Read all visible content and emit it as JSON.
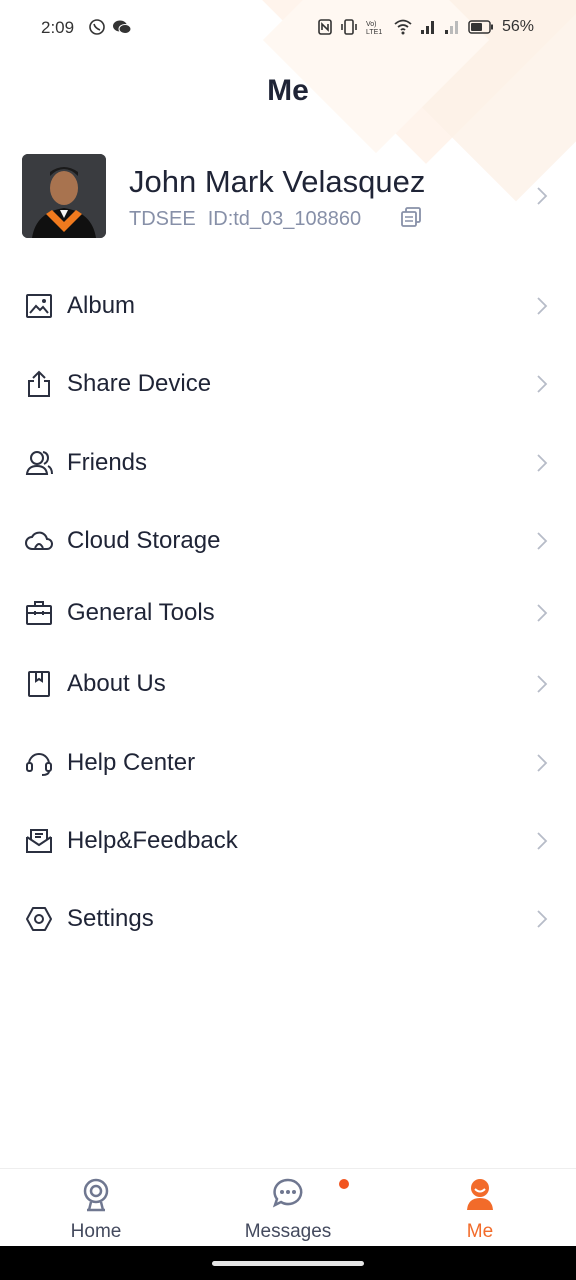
{
  "status_bar": {
    "time": "2:09",
    "battery": "56%",
    "icons": [
      "viber-icon",
      "wechat-icon",
      "nfc-icon",
      "vibrate-icon",
      "volte-icon",
      "wifi-icon",
      "signal-icon",
      "signal-weak-icon",
      "battery-icon"
    ]
  },
  "header": {
    "title": "Me"
  },
  "profile": {
    "name": "John Mark Velasquez",
    "brand": "TDSEE",
    "id": "ID:td_03_108860"
  },
  "menu": [
    {
      "label": "Album",
      "icon": "album-icon"
    },
    {
      "label": "Share Device",
      "icon": "share-icon"
    },
    {
      "label": "Friends",
      "icon": "friends-icon"
    },
    {
      "label": "Cloud Storage",
      "icon": "cloud-icon"
    },
    {
      "label": "General Tools",
      "icon": "toolbox-icon"
    },
    {
      "label": "About Us",
      "icon": "bookmark-icon"
    },
    {
      "label": "Help Center",
      "icon": "headset-icon"
    },
    {
      "label": "Help&Feedback",
      "icon": "mail-icon"
    },
    {
      "label": "Settings",
      "icon": "settings-icon"
    }
  ],
  "tabs": [
    {
      "label": "Home",
      "icon": "camera-icon",
      "active": false
    },
    {
      "label": "Messages",
      "icon": "chat-icon",
      "active": false,
      "badge": true
    },
    {
      "label": "Me",
      "icon": "person-icon",
      "active": true
    }
  ],
  "colors": {
    "accent": "#f26b2a",
    "text": "#1f2436",
    "muted": "#8790a8",
    "badge": "#f2541f"
  }
}
